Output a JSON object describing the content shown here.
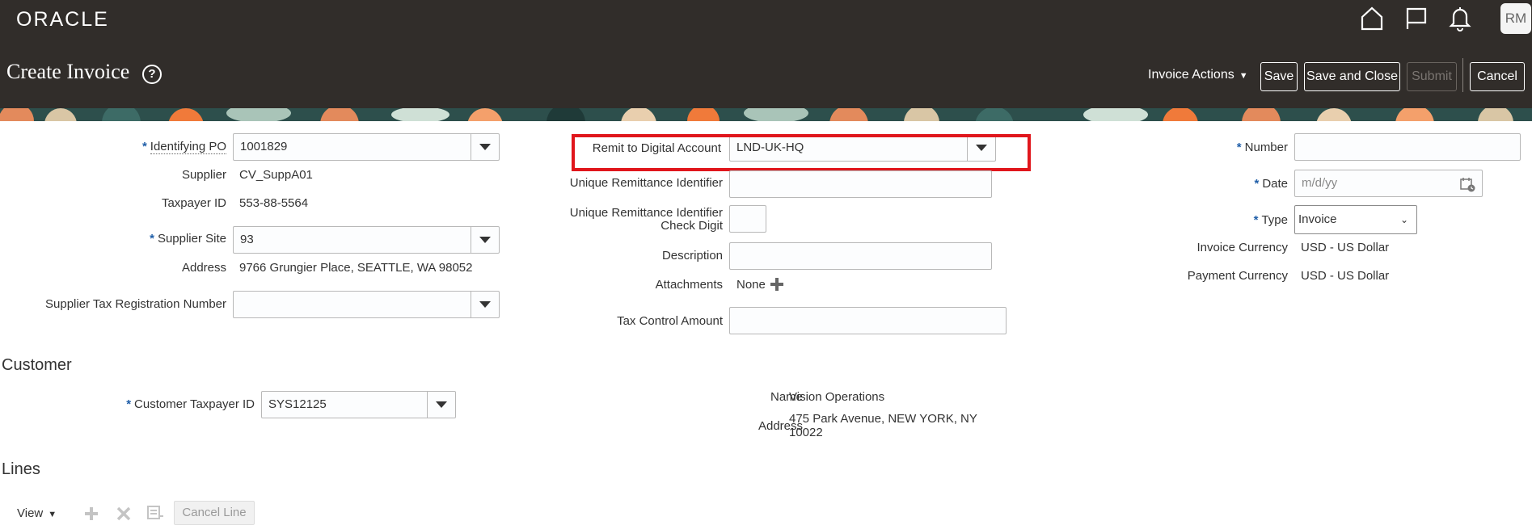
{
  "header": {
    "logo": "ORACLE",
    "avatar_initials": "RM",
    "page_title": "Create Invoice",
    "help_glyph": "?",
    "invoice_actions": "Invoice Actions",
    "buttons": {
      "save": "Save",
      "save_and_close": "Save and Close",
      "submit": "Submit",
      "cancel": "Cancel"
    }
  },
  "form": {
    "identifying_po": {
      "label": "Identifying PO",
      "value": "1001829"
    },
    "supplier": {
      "label": "Supplier",
      "value": "CV_SuppA01"
    },
    "taxpayer_id": {
      "label": "Taxpayer ID",
      "value": "553-88-5564"
    },
    "supplier_site": {
      "label": "Supplier Site",
      "value": "93"
    },
    "address": {
      "label": "Address",
      "value": "9766 Grungier Place, SEATTLE, WA 98052"
    },
    "supplier_tax_reg": {
      "label": "Supplier Tax Registration Number",
      "value": ""
    },
    "remit_account": {
      "label": "Remit to Digital Account",
      "value": "LND-UK-HQ"
    },
    "unique_remittance_id": {
      "label": "Unique Remittance Identifier",
      "value": ""
    },
    "check_digit": {
      "label_line1": "Unique Remittance Identifier",
      "label_line2": "Check Digit",
      "value": ""
    },
    "description": {
      "label": "Description",
      "value": ""
    },
    "attachments": {
      "label": "Attachments",
      "value": "None"
    },
    "tax_control_amount": {
      "label": "Tax Control Amount",
      "value": ""
    },
    "number": {
      "label": "Number",
      "value": ""
    },
    "date": {
      "label": "Date",
      "placeholder": "m/d/yy"
    },
    "type": {
      "label": "Type",
      "value": "Invoice"
    },
    "invoice_currency": {
      "label": "Invoice Currency",
      "value": "USD - US Dollar"
    },
    "payment_currency": {
      "label": "Payment Currency",
      "value": "USD - US Dollar"
    },
    "required_mark": "*"
  },
  "customer": {
    "section_title": "Customer",
    "taxpayer_id": {
      "label": "Customer Taxpayer ID",
      "value": "SYS12125"
    },
    "name": {
      "label": "Name",
      "value": "Vision Operations"
    },
    "address": {
      "label": "Address",
      "line1": "475 Park Avenue, NEW YORK, NY",
      "line2": "10022"
    }
  },
  "lines": {
    "section_title": "Lines",
    "view": "View",
    "cancel_line": "Cancel Line"
  },
  "colors": {
    "header_bg": "#312d2a",
    "highlight": "#e0161c",
    "required": "#1f5ea8"
  }
}
